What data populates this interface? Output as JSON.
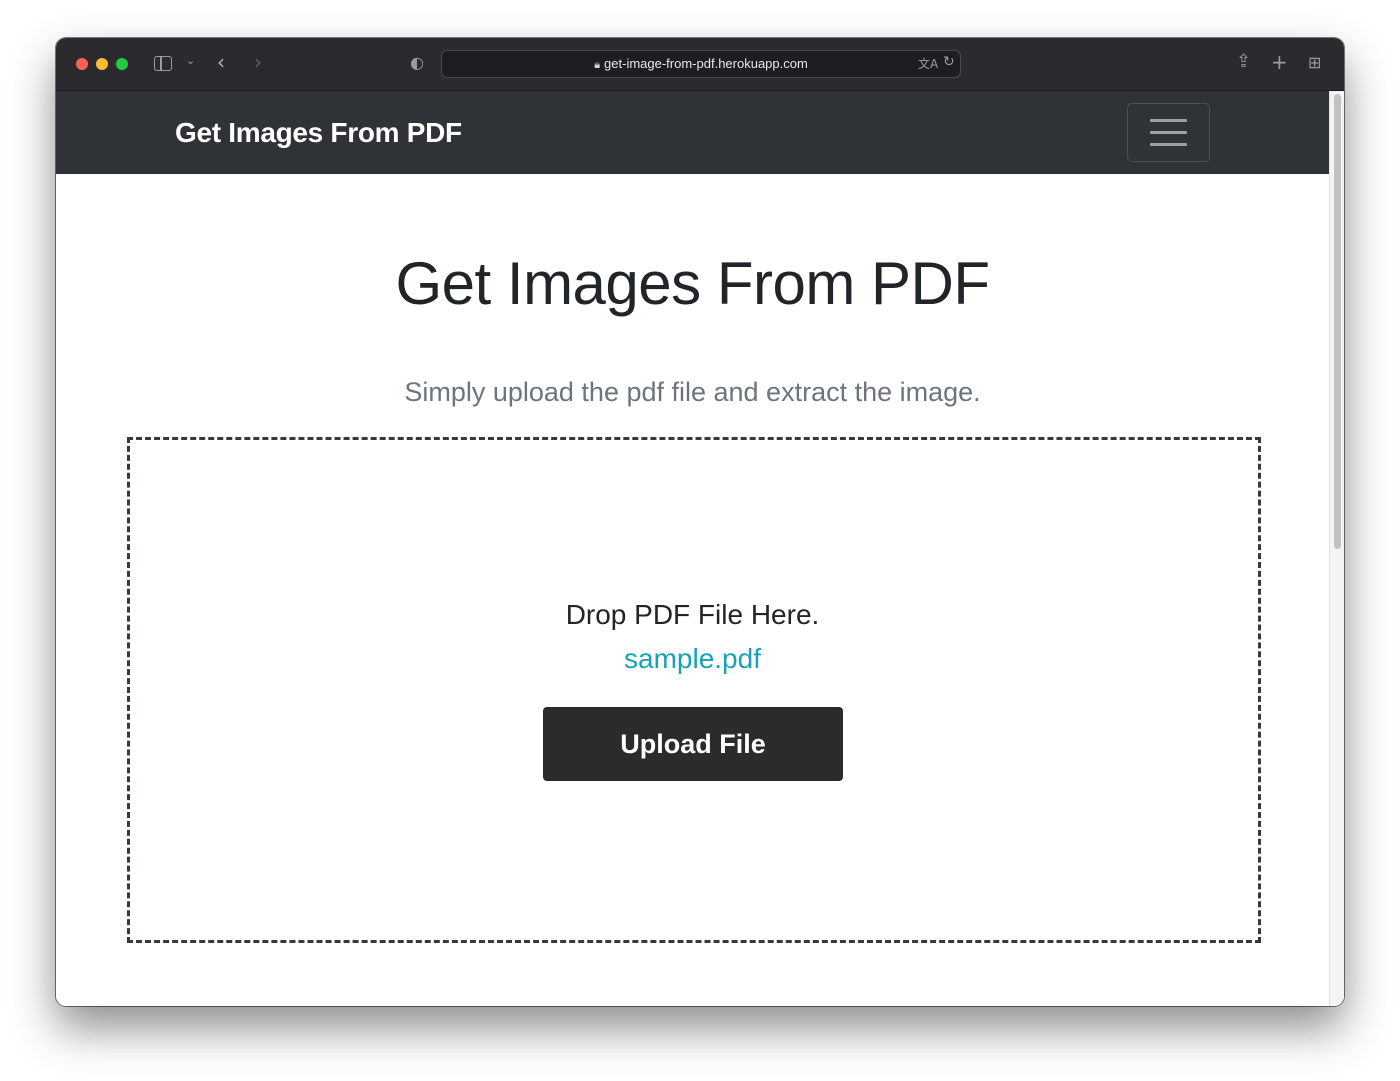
{
  "browser": {
    "url": "get-image-from-pdf.herokuapp.com"
  },
  "navbar": {
    "brand": "Get Images From PDF"
  },
  "hero": {
    "title": "Get Images From PDF",
    "subtitle": "Simply upload the pdf file and extract the image."
  },
  "dropzone": {
    "prompt": "Drop PDF File Here.",
    "file_name": "sample.pdf",
    "upload_label": "Upload File"
  },
  "colors": {
    "navbar_bg": "#2f3337",
    "file_link": "#17a2b8",
    "button_bg": "#2b2b2b"
  }
}
